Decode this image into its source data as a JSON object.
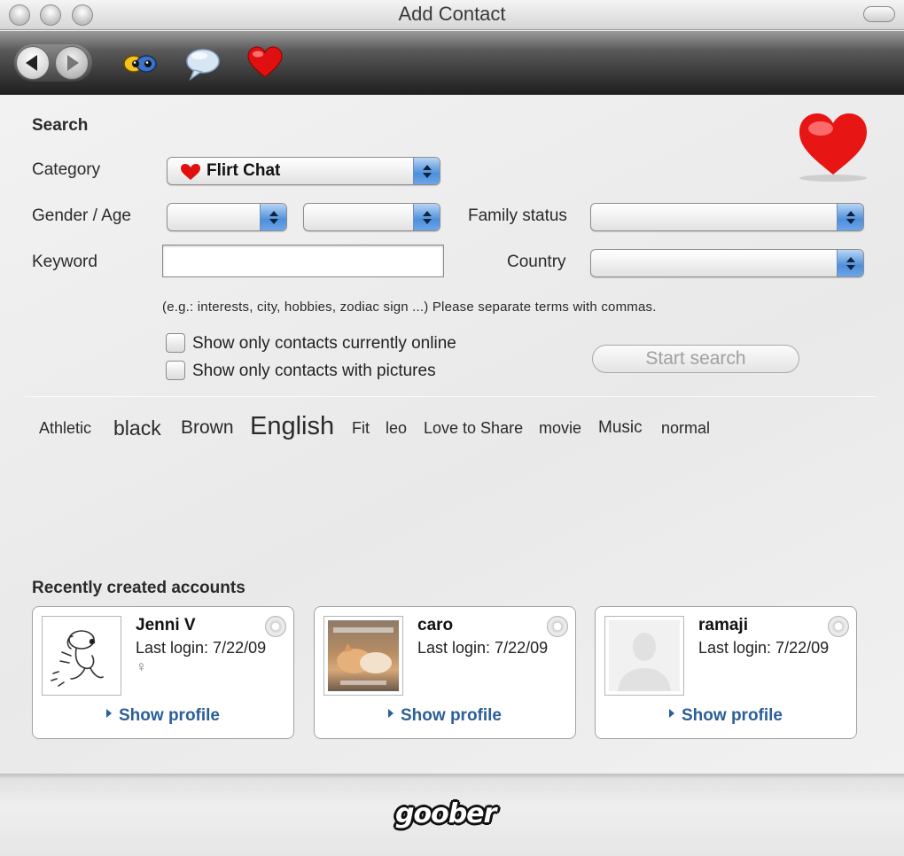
{
  "window": {
    "title": "Add Contact"
  },
  "toolbar": {
    "icons": [
      "back-icon",
      "forward-icon",
      "eyes-icon",
      "speech-bubble-icon",
      "heart-icon"
    ]
  },
  "search": {
    "section_title": "Search",
    "category_label": "Category",
    "category_value": "Flirt Chat",
    "gender_age_label": "Gender / Age",
    "gender_value": "",
    "age_value": "",
    "family_status_label": "Family status",
    "family_status_value": "",
    "keyword_label": "Keyword",
    "keyword_value": "",
    "country_label": "Country",
    "country_value": "",
    "hint": "(e.g.: interests, city, hobbies, zodiac sign ...) Please separate terms with commas.",
    "online_only_label": "Show only contacts currently online",
    "online_only_checked": false,
    "pictures_only_label": "Show only contacts with pictures",
    "pictures_only_checked": false,
    "start_button": "Start search"
  },
  "tags": [
    "Athletic",
    "black",
    "Brown",
    "English",
    "Fit",
    "leo",
    "Love to Share",
    "movie",
    "Music",
    "normal"
  ],
  "recent": {
    "title": "Recently created accounts",
    "accounts": [
      {
        "name": "Jenni V",
        "last_login": "Last login: 7/22/09",
        "gender": "♀",
        "show_profile": "Show profile",
        "avatar": "snoopy-avatar"
      },
      {
        "name": "caro",
        "last_login": "Last login: 7/22/09",
        "gender": "",
        "show_profile": "Show profile",
        "avatar": "cat-photo-avatar"
      },
      {
        "name": "ramaji",
        "last_login": "Last login: 7/22/09",
        "gender": "",
        "show_profile": "Show profile",
        "avatar": "placeholder-silhouette-avatar"
      }
    ]
  },
  "footer": {
    "logo": "goober"
  },
  "colors": {
    "accent_blue": "#4d8fdc",
    "link_blue": "#2c5e99",
    "heart_red": "#e01010"
  }
}
